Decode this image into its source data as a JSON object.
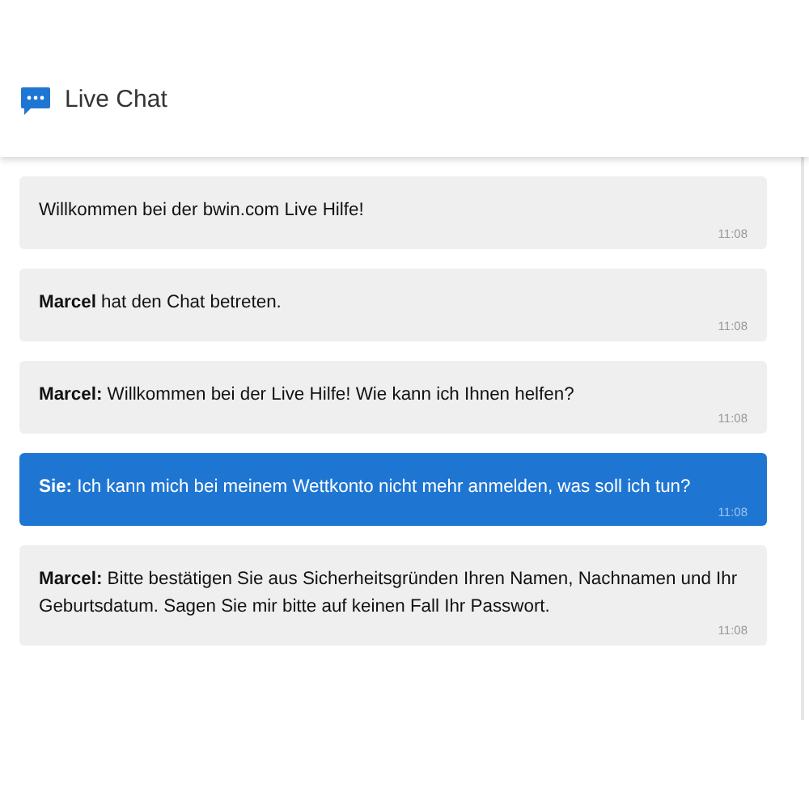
{
  "header": {
    "title": "Live Chat"
  },
  "messages": [
    {
      "kind": "agent",
      "text": "Willkommen bei der bwin.com Live Hilfe!",
      "time": "11:08"
    },
    {
      "kind": "agent",
      "text": "**Marcel** hat den Chat betreten.",
      "time": "11:08"
    },
    {
      "kind": "agent",
      "text": "**Marcel:** Willkommen bei der Live Hilfe! Wie kann ich Ihnen helfen?",
      "time": "11:08"
    },
    {
      "kind": "user",
      "text": "**Sie:** Ich kann mich bei meinem Wettkonto nicht mehr anmelden, was soll ich tun?",
      "time": "11:08"
    },
    {
      "kind": "agent",
      "text": "**Marcel:** Bitte bestätigen Sie aus Sicherheitsgründen Ihren Namen, Nachnamen und Ihr Geburtsdatum. Sagen Sie mir bitte auf keinen Fall Ihr Passwort.",
      "time": "11:08"
    }
  ]
}
